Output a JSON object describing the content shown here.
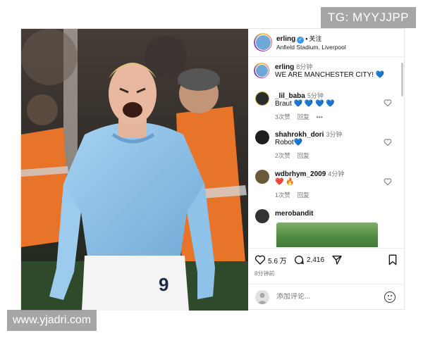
{
  "watermarks": {
    "top": "TG: MYYJJPP",
    "bottom": "www.yjadri.com"
  },
  "header": {
    "username": "erling",
    "separator": "•",
    "follow_label": "关注",
    "location": "Anfield Stadium, Liverpool"
  },
  "caption": {
    "username": "erling",
    "time": "8分钟",
    "text": "WE ARE MANCHESTER CITY!",
    "emoji": "💙"
  },
  "comments": [
    {
      "username": "_lil_baba",
      "time": "5分钟",
      "text": "Braut",
      "hearts": "💙 💙 💙 💙",
      "likes": "3次赞",
      "reply": "回复",
      "more": "•••",
      "avatar_color": "#2b2b2b"
    },
    {
      "username": "shahrokh_dori",
      "time": "3分钟",
      "text": "Robot",
      "hearts": "💙",
      "likes": "2次赞",
      "reply": "回复",
      "avatar_color": "#1e1e1e"
    },
    {
      "username": "wdbrhym_2009",
      "time": "4分钟",
      "text": "",
      "hearts": "❤️ 🔥",
      "likes": "1次赞",
      "reply": "回复",
      "avatar_color": "#6a5a3a"
    },
    {
      "username": "merobandit",
      "time": "",
      "text": "",
      "hearts": "",
      "avatar_color": "#333333"
    }
  ],
  "actions": {
    "likes_count": "5.6 万",
    "comments_count": "2,416",
    "time_ago": "8分钟前"
  },
  "add_comment": {
    "placeholder": "添加评论..."
  },
  "photo": {
    "jersey_number": "9"
  },
  "icons": [
    "heart-icon",
    "comment-icon",
    "share-icon",
    "bookmark-icon",
    "emoji-icon",
    "verified-icon"
  ],
  "colors": {
    "accent": "#3897f0",
    "jersey": "#8ec3ea",
    "steward_orange": "#e8742a"
  }
}
